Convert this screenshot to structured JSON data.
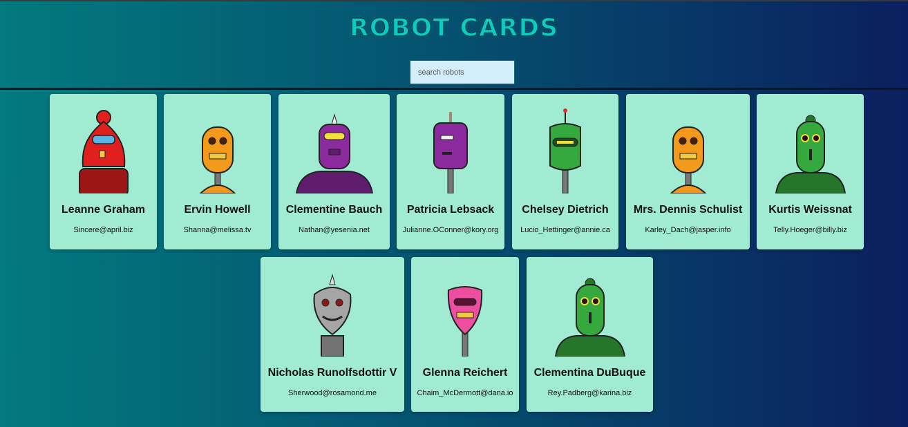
{
  "header": {
    "title": "ROBOT CARDS"
  },
  "search": {
    "placeholder": "search robots"
  },
  "robots": [
    {
      "name": "Leanne Graham",
      "email": "Sincere@april.biz",
      "color": "#e0201f"
    },
    {
      "name": "Ervin Howell",
      "email": "Shanna@melissa.tv",
      "color": "#f39a1c"
    },
    {
      "name": "Clementine Bauch",
      "email": "Nathan@yesenia.net",
      "color": "#8a2a9c"
    },
    {
      "name": "Patricia Lebsack",
      "email": "Julianne.OConner@kory.org",
      "color": "#8a2a9c"
    },
    {
      "name": "Chelsey Dietrich",
      "email": "Lucio_Hettinger@annie.ca",
      "color": "#35a83e"
    },
    {
      "name": "Mrs. Dennis Schulist",
      "email": "Karley_Dach@jasper.info",
      "color": "#f39a1c"
    },
    {
      "name": "Kurtis Weissnat",
      "email": "Telly.Hoeger@billy.biz",
      "color": "#35a83e"
    },
    {
      "name": "Nicholas Runolfsdottir V",
      "email": "Sherwood@rosamond.me",
      "color": "#a5a5a5"
    },
    {
      "name": "Glenna Reichert",
      "email": "Chaim_McDermott@dana.io",
      "color": "#ee4ea0"
    },
    {
      "name": "Clementina DuBuque",
      "email": "Rey.Padberg@karina.biz",
      "color": "#35a83e"
    }
  ]
}
